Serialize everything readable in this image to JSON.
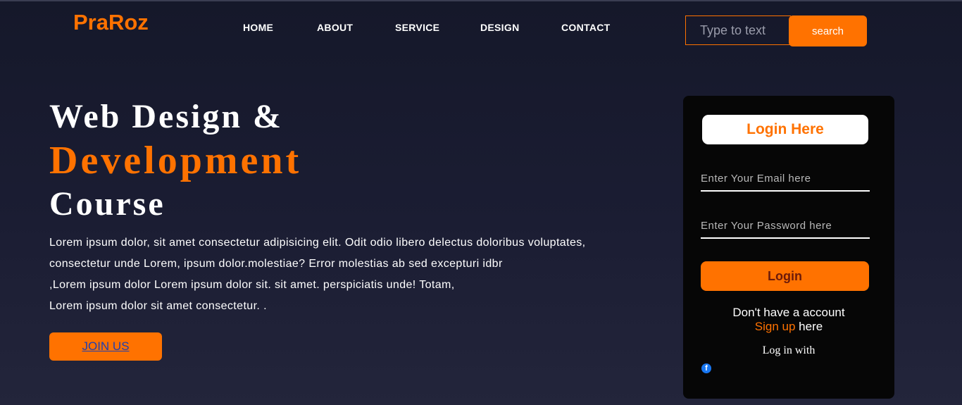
{
  "brand": {
    "logo": "PraRoz",
    "accent": "#ff7200"
  },
  "nav": {
    "items": [
      {
        "label": "HOME"
      },
      {
        "label": "ABOUT"
      },
      {
        "label": "SERVICE"
      },
      {
        "label": "DESIGN"
      },
      {
        "label": "CONTACT"
      }
    ]
  },
  "search": {
    "placeholder": "Type to text",
    "button_label": "search"
  },
  "hero": {
    "title_line1": "Web Design &",
    "title_line2": "Development",
    "title_line3": "Course",
    "paragraph_lines": [
      "Lorem ipsum dolor, sit amet consectetur adipisicing elit. Odit odio libero delectus doloribus voluptates,",
      "consectetur unde Lorem, ipsum dolor.molestiae? Error molestias ab sed excepturi idbr",
      ",Lorem ipsum dolor Lorem ipsum dolor sit. sit amet. perspiciatis unde! Totam,",
      "Lorem ipsum dolor sit amet consectetur. ."
    ],
    "join_label": "JOIN US"
  },
  "login": {
    "heading": "Login Here",
    "email_placeholder": "Enter Your Email here",
    "password_placeholder": "Enter Your Password here",
    "button_label": "Login",
    "no_account_text": "Don't have a account",
    "signup_link": "Sign up",
    "signup_suffix": " here",
    "login_with": "Log in with",
    "social_icon": "facebook-icon"
  }
}
